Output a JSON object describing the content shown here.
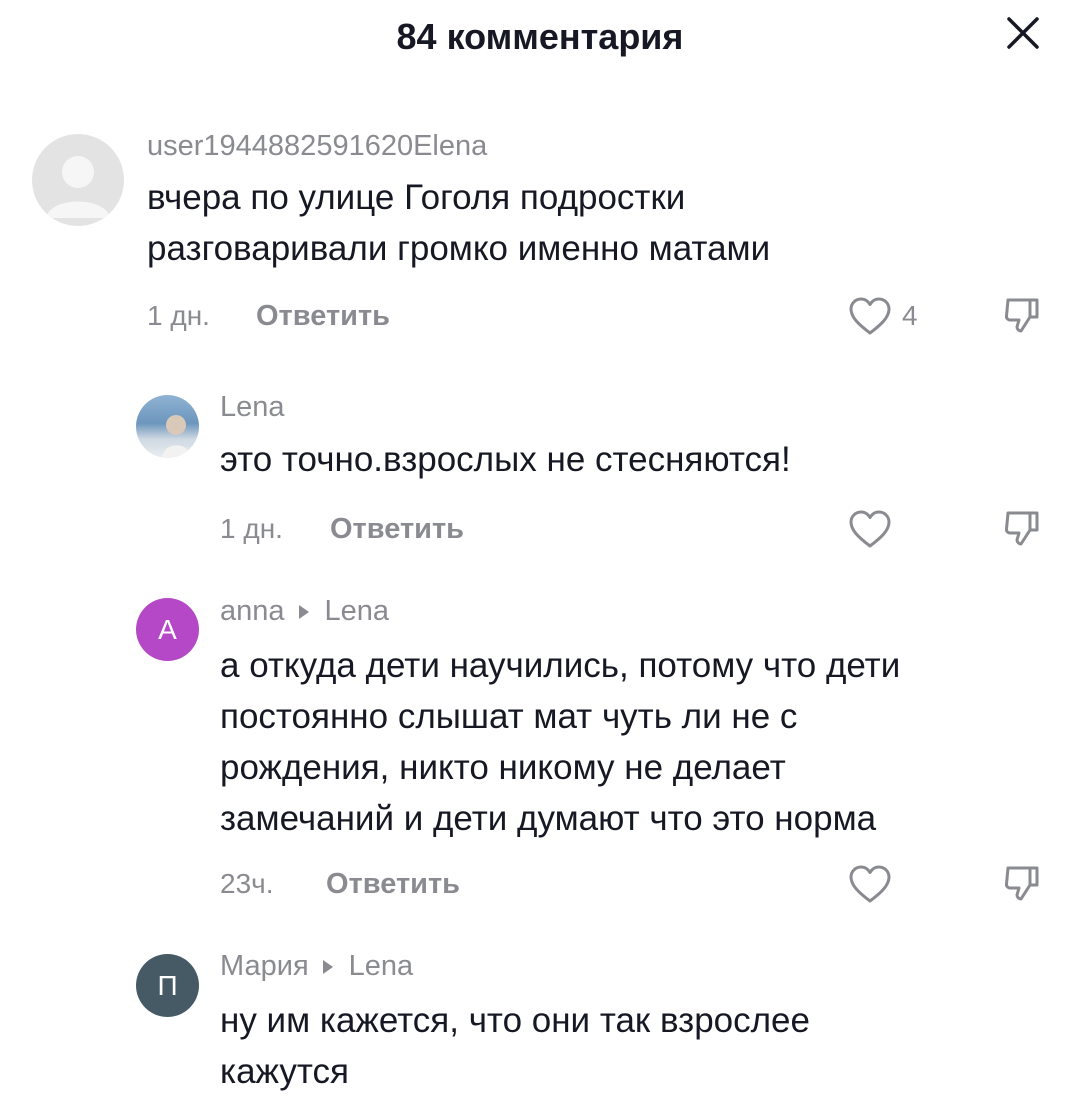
{
  "header": {
    "title": "84 комментария",
    "close_icon": "close-icon"
  },
  "comments": [
    {
      "username": "user1944882591620Elena",
      "text": "вчера по улице Гоголя подростки\nразговаривали громко именно матами",
      "timestamp": "1 дн.",
      "reply_label": "Ответить",
      "likes": "4",
      "avatar": {
        "type": "placeholder",
        "color": "#e3e3e4"
      }
    },
    {
      "username": "Lena",
      "text": "это точно.взрослых не стесняются!",
      "timestamp": "1 дн.",
      "reply_label": "Ответить",
      "avatar": {
        "type": "photo",
        "color": "#7fa3c4"
      }
    },
    {
      "username": "anna",
      "reply_to": "Lena",
      "text": "а откуда дети научились, потому что дети\nпостоянно слышат мат чуть ли не с\nрождения, никто никому не делает\nзамечаний и дети думают что это норма",
      "timestamp": "23ч.",
      "reply_label": "Ответить",
      "avatar": {
        "type": "letter",
        "letter": "A",
        "color": "#b548c6"
      }
    },
    {
      "username": "Мария",
      "reply_to": "Lena",
      "text": "ну им кажется, что они так взрослее\nкажутся",
      "avatar": {
        "type": "letter",
        "letter": "П",
        "color": "#455a64"
      }
    }
  ]
}
